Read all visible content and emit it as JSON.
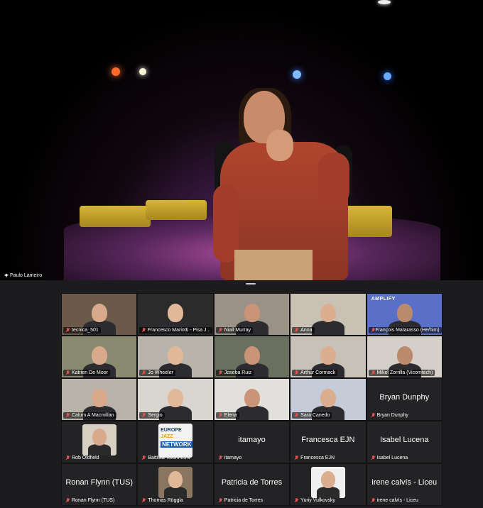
{
  "speaker": {
    "name": "Paulo Lameiro"
  },
  "tiles": [
    {
      "name": "tecnica_501",
      "type": "video",
      "bg": "#6b5a4a"
    },
    {
      "name": "Francesco Mariotti - Pisa J...",
      "type": "video",
      "bg": "#2b2b2b"
    },
    {
      "name": "Niall Murray",
      "type": "video",
      "bg": "#9a9286"
    },
    {
      "name": "Anna",
      "type": "video",
      "bg": "#c9c2b4"
    },
    {
      "name": "François Matarasso (He/him)",
      "type": "video",
      "bg": "#5a6fc8",
      "brand": "AMPLIFY"
    },
    {
      "name": "Katrien De Moor",
      "type": "video",
      "bg": "#8a8a70"
    },
    {
      "name": "Jo Wheeler",
      "type": "video",
      "bg": "#b9b4ab"
    },
    {
      "name": "Joseba Ruiz",
      "type": "video",
      "bg": "#6a7060"
    },
    {
      "name": "Arthur Cormack",
      "type": "video",
      "bg": "#c8c1b7"
    },
    {
      "name": "Mikel Zorrilla (Vicomtech)",
      "type": "video",
      "bg": "#d4d0c9"
    },
    {
      "name": "Calum A Macmillan",
      "type": "video",
      "bg": "#b9b3aa"
    },
    {
      "name": "Sergio",
      "type": "video",
      "bg": "#d9d6d0"
    },
    {
      "name": "Elena",
      "type": "video",
      "bg": "#e2e0dc"
    },
    {
      "name": "Sara Canedo",
      "type": "video",
      "bg": "#c5ccd8"
    },
    {
      "name": "Bryan Dunphy",
      "type": "text",
      "big": "Bryan Dunphy"
    },
    {
      "name": "Rob Oldfield",
      "type": "photo",
      "bg": "#d9d0c4"
    },
    {
      "name": "Battista Tofoni EJN",
      "type": "ejn",
      "logo": [
        "EUROPE",
        "JAZZ",
        "NETWORK"
      ]
    },
    {
      "name": "itamayo",
      "type": "text",
      "big": "itamayo"
    },
    {
      "name": "Francesca EJN",
      "type": "text",
      "big": "Francesca EJN"
    },
    {
      "name": "Isabel Lucena",
      "type": "text",
      "big": "Isabel Lucena"
    },
    {
      "name": "Ronan Flynn (TUS)",
      "type": "text",
      "big": "Ronan Flynn (TUS)"
    },
    {
      "name": "Thomas Röggla",
      "type": "photo",
      "bg": "#8a7560"
    },
    {
      "name": "Patricia de Torres",
      "type": "text",
      "big": "Patricia de Torres"
    },
    {
      "name": "Yuriy Vulkovsky",
      "type": "photo",
      "bg": "#f0f0f0"
    },
    {
      "name": "irene calvís - Liceu",
      "type": "text",
      "big": "irene calvís - Liceu"
    }
  ]
}
